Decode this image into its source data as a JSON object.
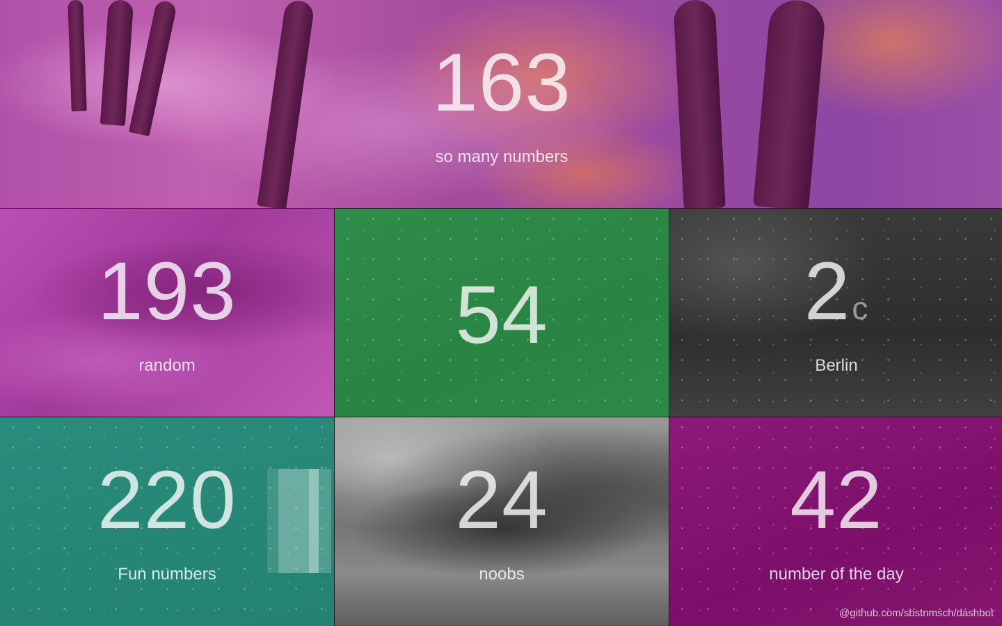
{
  "tiles": [
    {
      "value": "163",
      "label": "so many numbers",
      "theme": "forest"
    },
    {
      "value": "193",
      "label": "random",
      "theme": "magenta"
    },
    {
      "value": "54",
      "label": "",
      "theme": "green"
    },
    {
      "value": "2",
      "unit": "c",
      "label": "Berlin",
      "theme": "gray"
    },
    {
      "value": "220",
      "label": "Fun numbers",
      "theme": "teal"
    },
    {
      "value": "24",
      "label": "noobs",
      "theme": "storm"
    },
    {
      "value": "42",
      "label": "number of the day",
      "theme": "purple"
    }
  ],
  "footer": {
    "link": "@github.com/sbstnmsch/dashbot"
  },
  "colors": {
    "forest": "#a44c9c",
    "magenta": "#b94fb4",
    "green": "#2f8c49",
    "gray": "#3a3a3a",
    "teal": "#2a8c7c",
    "storm": "#7a7a7a",
    "purple": "#8c1a78"
  }
}
